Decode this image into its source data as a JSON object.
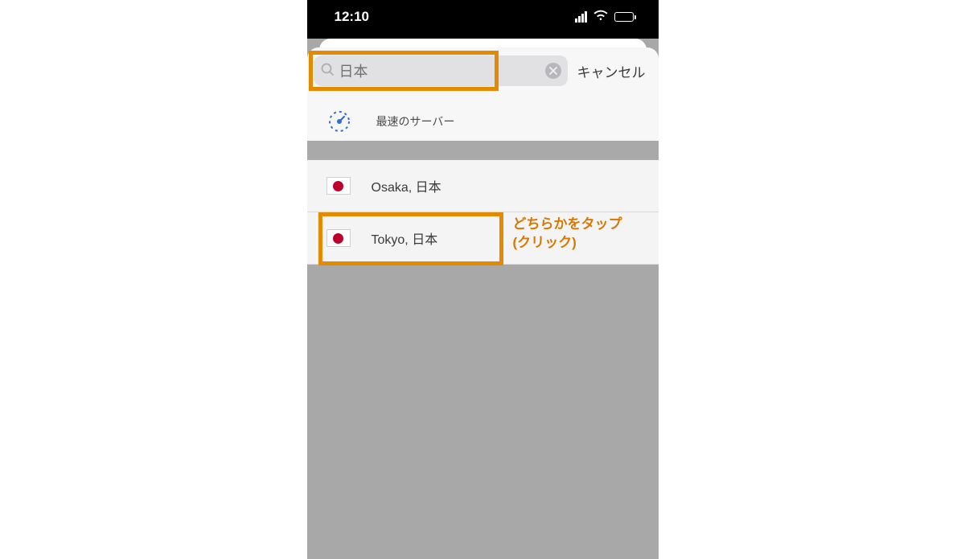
{
  "status_bar": {
    "time": "12:10"
  },
  "search": {
    "value": "日本",
    "cancel_label": "キャンセル"
  },
  "fastest": {
    "label": "最速のサーバー"
  },
  "results": [
    {
      "label": "Osaka, 日本"
    },
    {
      "label": "Tokyo, 日本"
    }
  ],
  "annotation": {
    "line1": "どちらかをタップ",
    "line2": "(クリック)"
  },
  "colors": {
    "highlight": "#e38a00",
    "annotation_text": "#d97800",
    "flag_red": "#bc002d"
  }
}
